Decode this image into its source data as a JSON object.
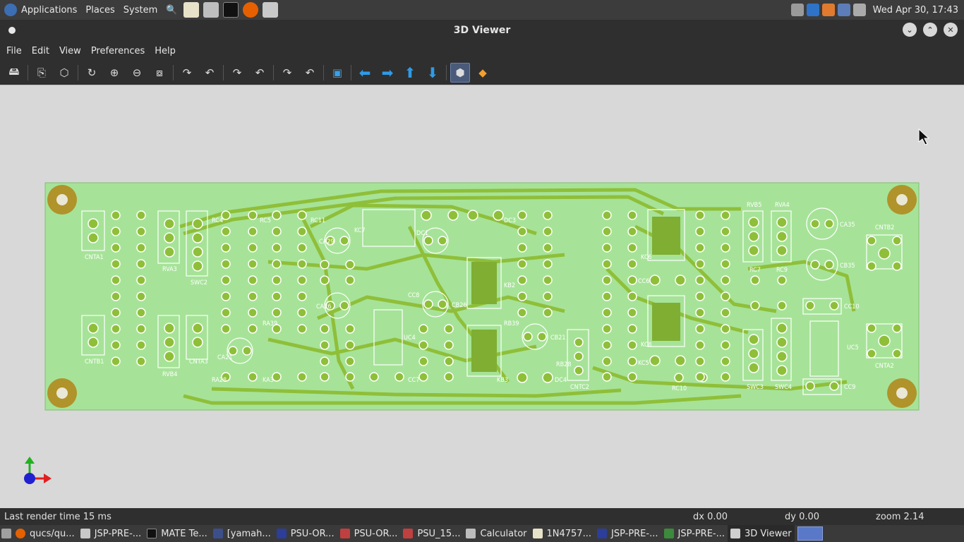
{
  "topbar": {
    "menus": [
      "Applications",
      "Places",
      "System"
    ],
    "datetime": "Wed Apr 30, 17:43"
  },
  "window": {
    "title": "3D Viewer"
  },
  "menubar": {
    "items": [
      "File",
      "Edit",
      "View",
      "Preferences",
      "Help"
    ]
  },
  "status": {
    "render_time": "Last render time 15 ms",
    "dx": "dx 0.00",
    "dy": "dy 0.00",
    "zoom": "zoom 2.14"
  },
  "taskbar": {
    "tasks": [
      "qucs/qu...",
      "JSP-PRE-...",
      "MATE Te...",
      "[yamah...",
      "PSU-OR...",
      "PSU-OR...",
      "PSU_15...",
      "Calculator",
      "1N4757...",
      "JSP-PRE-...",
      "JSP-PRE-...",
      "3D Viewer"
    ]
  },
  "pcb": {
    "labels": [
      "CNTA1",
      "CNTB1",
      "RVA3",
      "RVB4",
      "SWC2",
      "CNTA3",
      "RVB5",
      "RVA4",
      "RC7",
      "RC9",
      "SWC3",
      "SWC4",
      "CNTB2",
      "CNTA2",
      "CNTC2",
      "RC10",
      "CC9",
      "CC10",
      "CA35",
      "CB35",
      "CA29",
      "RC11",
      "RC5",
      "RC4",
      "KC7",
      "DC1",
      "DC3",
      "KB2",
      "KB3",
      "KA3",
      "CA21",
      "CA26",
      "CB26",
      "CB21",
      "CC7",
      "CC8",
      "CC6",
      "DC4",
      "KC5",
      "KC6",
      "KC8",
      "RB28",
      "RA28",
      "RB39",
      "RA39",
      "UC5",
      "UC4"
    ]
  },
  "colors": {
    "board": "#a6e398",
    "copper": "#8fbf39",
    "silk": "#ffffff",
    "mount": "#b0932a"
  }
}
